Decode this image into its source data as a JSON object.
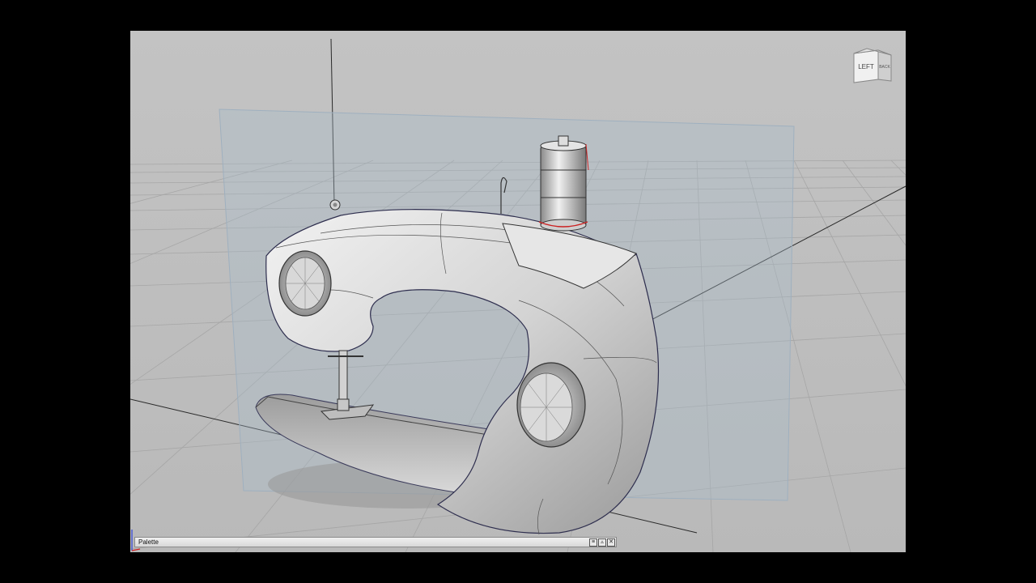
{
  "viewcube": {
    "face_left": "LEFT",
    "face_back": "BACK"
  },
  "palette": {
    "title": "Palette",
    "icons": [
      "menu-icon",
      "collapse-icon",
      "close-icon"
    ]
  },
  "colors": {
    "background": "#000000",
    "viewport": "#c0c0c0",
    "grid": "#a3a3a3",
    "model_surface": "#dcdcdc",
    "construction_plane": "#9fb2c4",
    "selection_curve": "#cc2222"
  }
}
